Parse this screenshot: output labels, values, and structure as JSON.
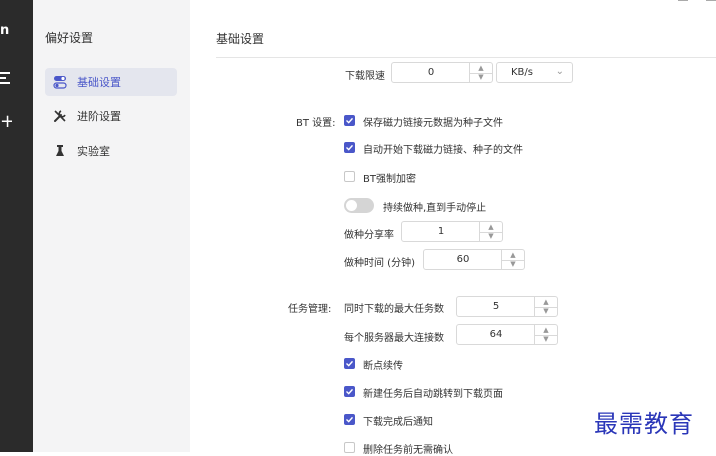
{
  "rail": {
    "logo_text": "n",
    "plus_text": "+"
  },
  "sidebar": {
    "title": "偏好设置",
    "items": [
      {
        "label": "基础设置",
        "icon": "toggle-icon",
        "active": true
      },
      {
        "label": "进阶设置",
        "icon": "tools-icon",
        "active": false
      },
      {
        "label": "实验室",
        "icon": "flask-icon",
        "active": false
      }
    ]
  },
  "main": {
    "title": "基础设置",
    "speed_limit": {
      "label": "下载限速",
      "value": "0",
      "unit": "KB/s"
    },
    "bt": {
      "section_label": "BT 设置:",
      "opt1": {
        "label": "保存磁力链接元数据为种子文件",
        "checked": true
      },
      "opt2": {
        "label": "自动开始下载磁力链接、种子的文件",
        "checked": true
      },
      "opt3": {
        "label": "BT强制加密",
        "checked": false
      },
      "seeding": {
        "label": "持续做种,直到手动停止",
        "on": false
      },
      "ratio": {
        "label": "做种分享率",
        "value": "1"
      },
      "seed_time": {
        "label": "做种时间 (分钟)",
        "value": "60"
      }
    },
    "task": {
      "section_label": "任务管理:",
      "max_tasks": {
        "label": "同时下载的最大任务数",
        "value": "5"
      },
      "max_conn": {
        "label": "每个服务器最大连接数",
        "value": "64"
      },
      "opt1": {
        "label": "断点续传",
        "checked": true
      },
      "opt2": {
        "label": "新建任务后自动跳转到下载页面",
        "checked": true
      },
      "opt3": {
        "label": "下载完成后通知",
        "checked": true
      },
      "opt4": {
        "label": "删除任务前无需确认",
        "checked": false
      }
    }
  },
  "watermark": "最需教育",
  "colors": {
    "accent": "#4a57c9",
    "rail": "#2b2b2b",
    "sidebar": "#f4f4f5"
  }
}
